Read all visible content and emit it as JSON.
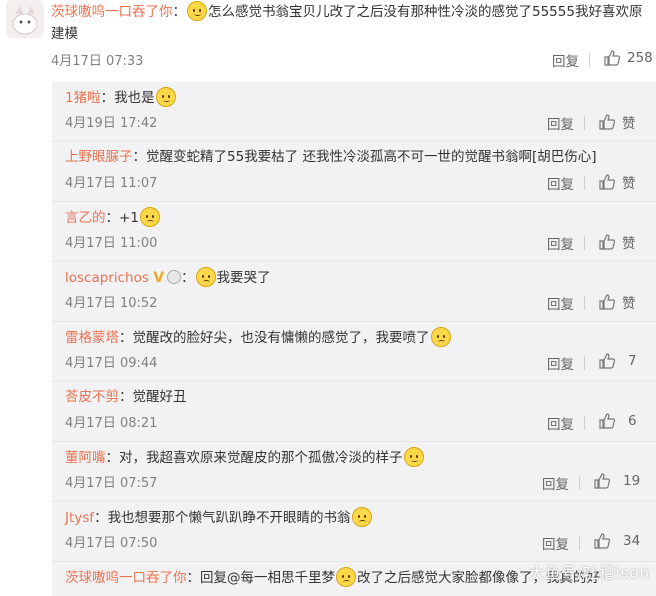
{
  "main_comment": {
    "username": "茨球嗷呜一口吞了你",
    "text_before_emoji": "：",
    "text_after_emoji": "怎么感觉书翁宝贝儿改了之后没有那种性冷淡的感觉了55555我好喜欢原建模",
    "date": "4月17日 07:33",
    "reply_label": "回复",
    "like_count": "258"
  },
  "replies": [
    {
      "username": "1猪啦",
      "sep": "：",
      "text": "我也是",
      "emoji": "cry",
      "date": "4月19日 17:42",
      "reply_label": "回复",
      "like_label": "赞"
    },
    {
      "username": "上野眼脲子",
      "sep": "：",
      "text": "觉醒变蛇精了55我要枯了 还我性冷淡孤高不可一世的觉醒书翁啊[胡巴伤心]",
      "emoji": "",
      "date": "4月17日 11:07",
      "reply_label": "回复",
      "like_label": "赞"
    },
    {
      "username": "言乙的",
      "sep": "：",
      "text": "+1",
      "emoji": "sad",
      "date": "4月17日 11:00",
      "reply_label": "回复",
      "like_label": "赞"
    },
    {
      "username": "loscaprichos",
      "sep": "：",
      "text": "我要哭了",
      "emoji": "sad",
      "date": "4月17日 10:52",
      "reply_label": "回复",
      "like_label": "赞"
    },
    {
      "username": "雷格蒙塔",
      "sep": "：",
      "text": "觉醒改的脸好尖，也没有慵懒的感觉了，我要喷了",
      "emoji": "sad",
      "date": "4月17日 09:44",
      "reply_label": "回复",
      "like_label": "7"
    },
    {
      "username": "荅皮不剪",
      "sep": "：",
      "text": "觉醒好丑",
      "emoji": "",
      "date": "4月17日 08:21",
      "reply_label": "回复",
      "like_label": "6"
    },
    {
      "username": "董阿嘴",
      "sep": "：",
      "text": "对，我超喜欢原来觉醒皮的那个孤傲冷淡的样子",
      "emoji": "cry",
      "date": "4月17日 07:57",
      "reply_label": "回复",
      "like_label": "19"
    },
    {
      "username": "Jtysf",
      "sep": "：",
      "text": "我也想要那个懒气趴趴睁不开眼睛的书翁",
      "emoji": "sad",
      "date": "4月17日 07:50",
      "reply_label": "回复",
      "like_label": "34"
    },
    {
      "username": "茨球嗷呜一口吞了你",
      "sep": "：",
      "text": "回复@每一相思千里梦",
      "emoji": "sad",
      "text2": "改了之后感觉大家脸都像像了，我真的好",
      "date": "",
      "reply_label": "",
      "like_label": ""
    }
  ],
  "watermark": "大鱼号/吐槽ison",
  "colors": {
    "username": "#eb7350",
    "reply_bg": "#f2f2f5",
    "meta": "#808080"
  }
}
